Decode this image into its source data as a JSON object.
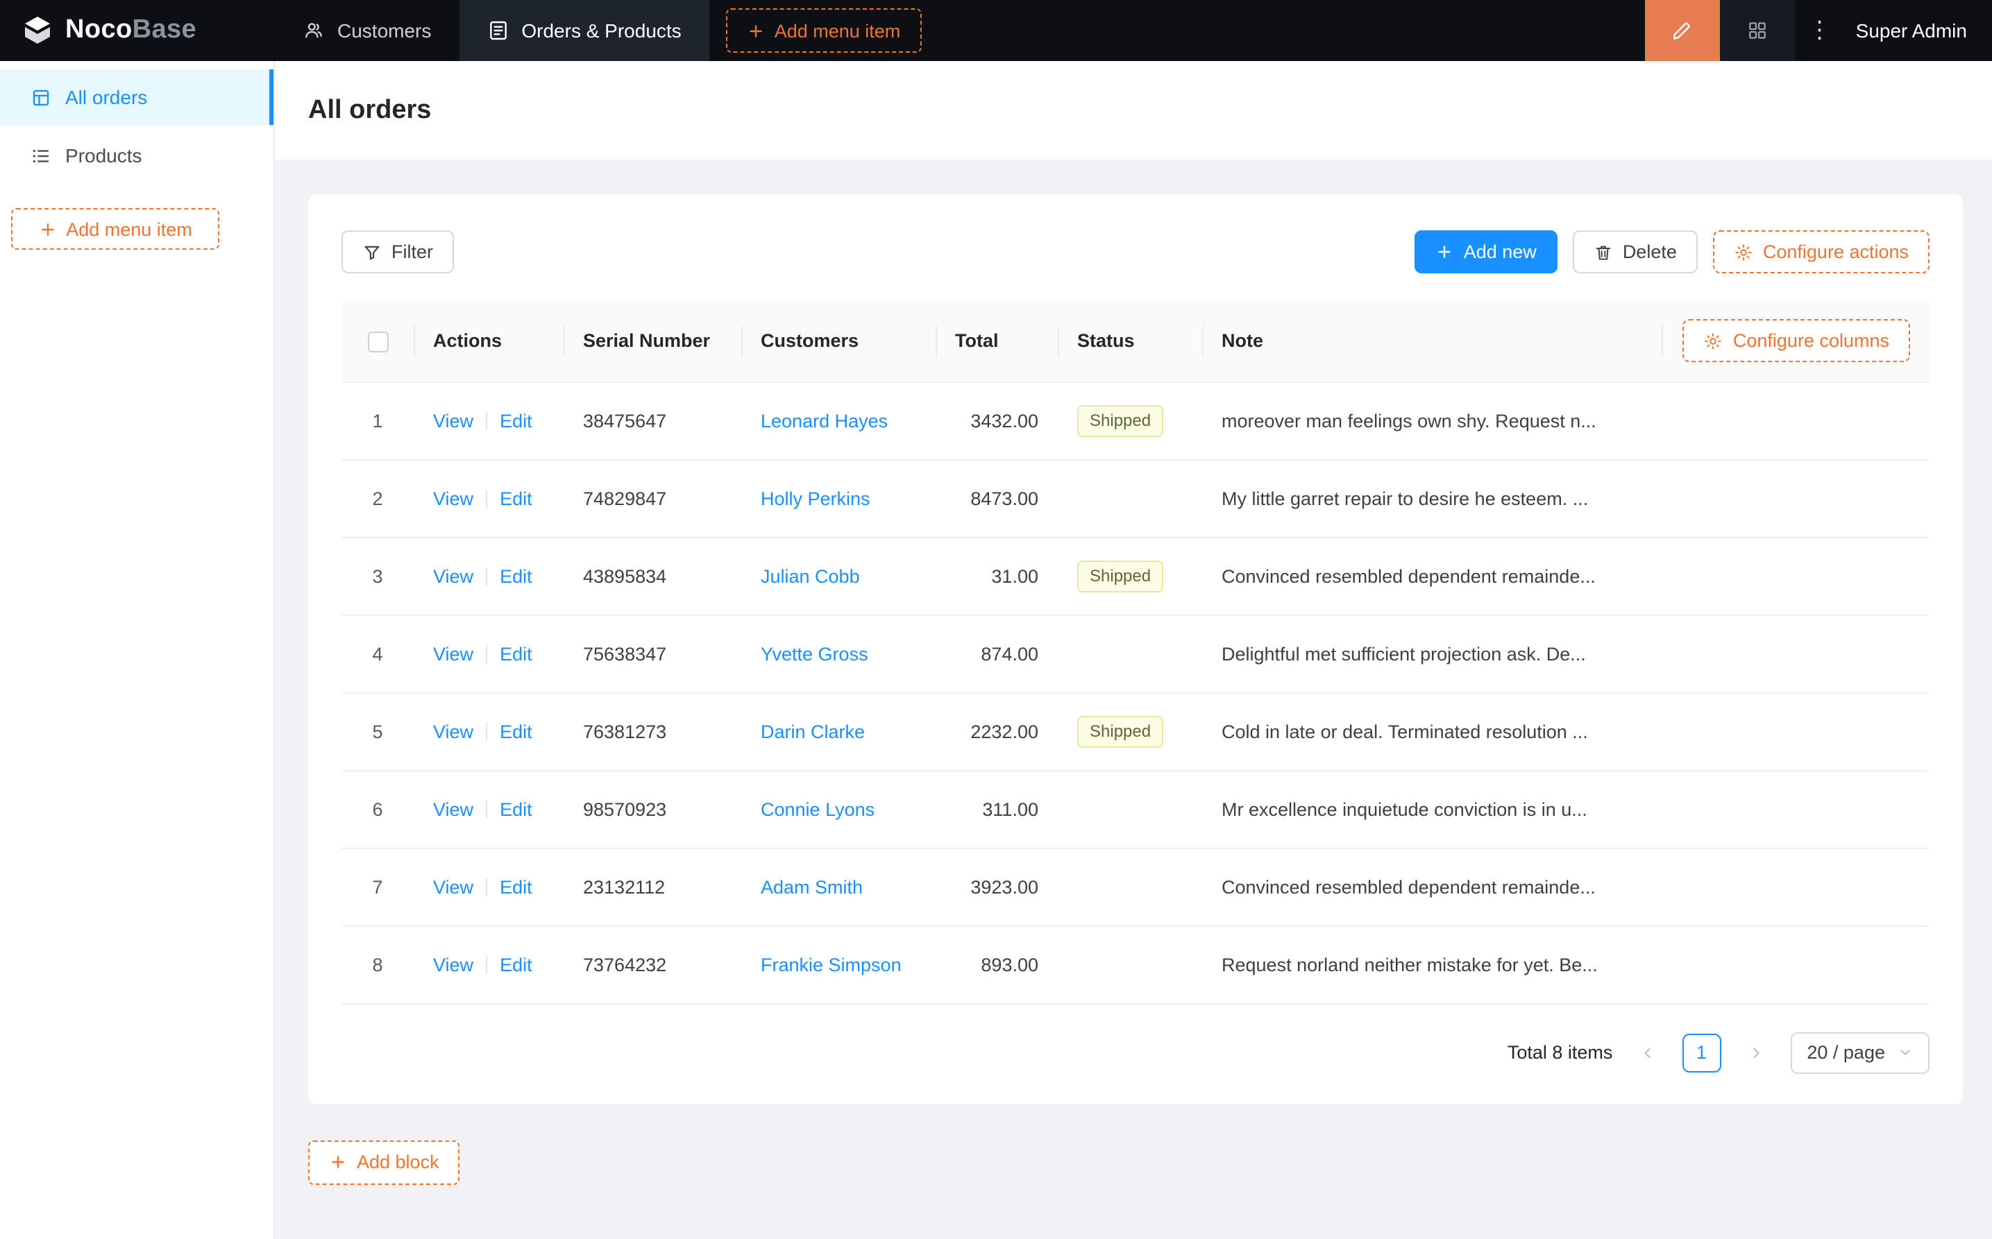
{
  "app": {
    "logo_primary": "Noco",
    "logo_secondary": "Base",
    "user": "Super Admin"
  },
  "topnav": {
    "items": [
      {
        "label": "Customers",
        "active": false
      },
      {
        "label": "Orders & Products",
        "active": true
      }
    ],
    "add_menu_item_label": "Add menu item"
  },
  "sidebar": {
    "items": [
      {
        "label": "All orders",
        "active": true
      },
      {
        "label": "Products",
        "active": false
      }
    ],
    "add_menu_item_label": "Add menu item"
  },
  "page": {
    "title": "All orders",
    "add_block_label": "Add block"
  },
  "toolbar": {
    "filter_label": "Filter",
    "add_new_label": "Add new",
    "delete_label": "Delete",
    "configure_actions_label": "Configure actions"
  },
  "table": {
    "configure_columns_label": "Configure columns",
    "columns": [
      "Actions",
      "Serial Number",
      "Customers",
      "Total",
      "Status",
      "Note"
    ],
    "action_labels": {
      "view": "View",
      "edit": "Edit"
    },
    "rows": [
      {
        "index": "1",
        "serial": "38475647",
        "customer": "Leonard Hayes",
        "total": "3432.00",
        "status": "Shipped",
        "note": "moreover man feelings own shy. Request n..."
      },
      {
        "index": "2",
        "serial": "74829847",
        "customer": "Holly Perkins",
        "total": "8473.00",
        "status": null,
        "note": "My little garret repair to desire he esteem. ..."
      },
      {
        "index": "3",
        "serial": "43895834",
        "customer": "Julian Cobb",
        "total": "31.00",
        "status": "Shipped",
        "note": "Convinced resembled dependent remainde..."
      },
      {
        "index": "4",
        "serial": "75638347",
        "customer": "Yvette Gross",
        "total": "874.00",
        "status": null,
        "note": "Delightful met sufficient projection ask. De..."
      },
      {
        "index": "5",
        "serial": "76381273",
        "customer": "Darin Clarke",
        "total": "2232.00",
        "status": "Shipped",
        "note": "Cold in late or deal. Terminated resolution ..."
      },
      {
        "index": "6",
        "serial": "98570923",
        "customer": "Connie Lyons",
        "total": "311.00",
        "status": null,
        "note": "Mr excellence inquietude conviction is in u..."
      },
      {
        "index": "7",
        "serial": "23132112",
        "customer": "Adam Smith",
        "total": "3923.00",
        "status": null,
        "note": "Convinced resembled dependent remainde..."
      },
      {
        "index": "8",
        "serial": "73764232",
        "customer": "Frankie Simpson",
        "total": "893.00",
        "status": null,
        "note": "Request norland neither mistake for yet. Be..."
      }
    ]
  },
  "pagination": {
    "total_text": "Total 8 items",
    "current_page": "1",
    "page_size": "20 / page"
  },
  "colors": {
    "header_bg": "#0c1014",
    "accent_orange": "#ee7430",
    "highlight_button_bg": "#e87d52",
    "primary_blue": "#1890ff",
    "sidebar_active_bg": "#e6f7ff",
    "tag_shipped_bg": "#fcffe6",
    "tag_shipped_border": "#e2ec9a",
    "content_bg": "#f0f2f5"
  }
}
